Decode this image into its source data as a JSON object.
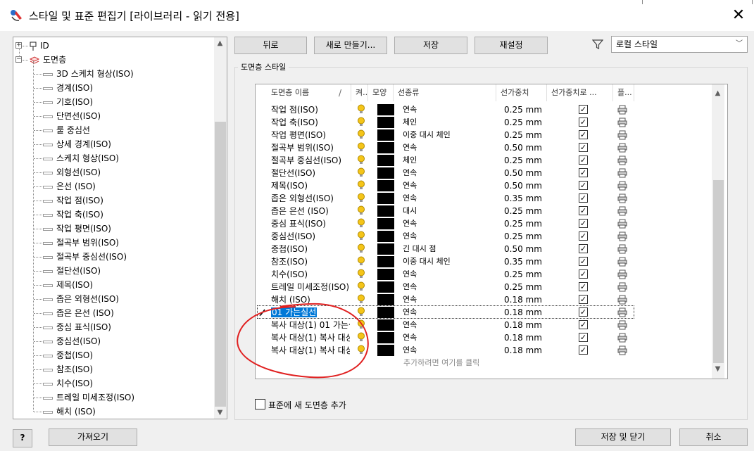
{
  "window": {
    "title": "스타일 및 표준 편집기 [라이브러리 - 읽기 전용]",
    "close_glyph": "✕",
    "icon": "app-style-editor-icon"
  },
  "tree": {
    "root_items": [
      {
        "label": "ID",
        "icon": "id-pin-icon",
        "expander": "+"
      },
      {
        "label": "도면층",
        "icon": "layers-icon",
        "expander": "−"
      }
    ],
    "children": [
      "3D 스케치 형상(ISO)",
      "경계(ISO)",
      "기호(ISO)",
      "단면선(ISO)",
      "룰 중심선",
      "상세 경계(ISO)",
      "스케치 형상(ISO)",
      "외형선(ISO)",
      "은선 (ISO)",
      "작업 점(ISO)",
      "작업 축(ISO)",
      "작업 평면(ISO)",
      "절곡부 범위(ISO)",
      "절곡부 중심선(ISO)",
      "절단선(ISO)",
      "제목(ISO)",
      "좁은 외형선(ISO)",
      "좁은 은선 (ISO)",
      "중심 표식(ISO)",
      "중심선(ISO)",
      "중첩(ISO)",
      "참조(ISO)",
      "치수(ISO)",
      "트레일 미세조정(ISO)",
      "해치 (ISO)"
    ]
  },
  "toolbar": {
    "back": "뒤로",
    "new": "새로 만들기...",
    "save": "저장",
    "reset": "재설정",
    "filter_icon": "filter-funnel-icon",
    "style_filter": "로컬 스타일"
  },
  "group": {
    "label": "도면층 스타일",
    "columns": [
      "도면층 이름",
      "켜..",
      "모양",
      "선종류",
      "선가중치",
      "선가중치로 ...",
      "플..."
    ],
    "rows": [
      {
        "name": "작업 점(ISO)",
        "linetype": "연속",
        "weight": "0.25 mm",
        "scale": true
      },
      {
        "name": "작업 축(ISO)",
        "linetype": "체인",
        "weight": "0.25 mm",
        "scale": true
      },
      {
        "name": "작업 평면(ISO)",
        "linetype": "이중 대시 체인",
        "weight": "0.25 mm",
        "scale": true
      },
      {
        "name": "절곡부 범위(ISO)",
        "linetype": "연속",
        "weight": "0.50 mm",
        "scale": true
      },
      {
        "name": "절곡부 중심선(ISO)",
        "linetype": "체인",
        "weight": "0.25 mm",
        "scale": true
      },
      {
        "name": "절단선(ISO)",
        "linetype": "연속",
        "weight": "0.50 mm",
        "scale": true
      },
      {
        "name": "제목(ISO)",
        "linetype": "연속",
        "weight": "0.50 mm",
        "scale": true
      },
      {
        "name": "좁은 외형선(ISO)",
        "linetype": "연속",
        "weight": "0.35 mm",
        "scale": true
      },
      {
        "name": "좁은 은선 (ISO)",
        "linetype": "대시",
        "weight": "0.25 mm",
        "scale": true
      },
      {
        "name": "중심 표식(ISO)",
        "linetype": "연속",
        "weight": "0.25 mm",
        "scale": true
      },
      {
        "name": "중심선(ISO)",
        "linetype": "연속",
        "weight": "0.25 mm",
        "scale": true
      },
      {
        "name": "중첩(ISO)",
        "linetype": "긴 대시 점",
        "weight": "0.50 mm",
        "scale": true
      },
      {
        "name": "참조(ISO)",
        "linetype": "이중 대시 체인",
        "weight": "0.35 mm",
        "scale": true
      },
      {
        "name": "치수(ISO)",
        "linetype": "연속",
        "weight": "0.25 mm",
        "scale": true
      },
      {
        "name": "트레일 미세조정(ISO)",
        "linetype": "연속",
        "weight": "0.25 mm",
        "scale": true
      },
      {
        "name": "해치 (ISO)",
        "linetype": "연속",
        "weight": "0.18 mm",
        "scale": true
      },
      {
        "name": "01 가는실선",
        "linetype": "연속",
        "weight": "0.18 mm",
        "scale": true,
        "editing": true
      },
      {
        "name": "복사 대상(1) 01 가는실",
        "linetype": "연속",
        "weight": "0.18 mm",
        "scale": true
      },
      {
        "name": "복사 대상(1) 복사 대상",
        "linetype": "연속",
        "weight": "0.18 mm",
        "scale": true
      },
      {
        "name": "복사 대상(1) 복사 대상",
        "linetype": "연속",
        "weight": "0.18 mm",
        "scale": true
      }
    ],
    "add_prompt": "추가하려면 여기를 클릭",
    "add_to_standard": "표준에 새 도면층 추가",
    "sort_glyph": "/"
  },
  "footer": {
    "help_glyph": "?",
    "import": "가져오기",
    "save_close": "저장 및 닫기",
    "cancel": "취소"
  },
  "colors": {
    "annotation": "#e02020",
    "selection": "#0078d7",
    "bulb": "#f5c518"
  }
}
